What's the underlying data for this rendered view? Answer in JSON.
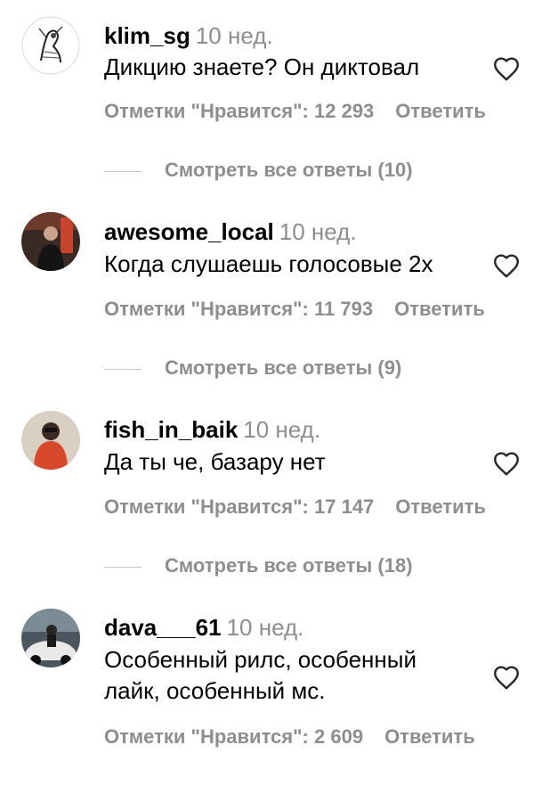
{
  "comments": [
    {
      "username": "klim_sg",
      "time": "10 нед.",
      "text": "Дикцию знаете? Он диктовал",
      "likes": "Отметки \"Нравится\": 12 293",
      "reply_label": "Ответить",
      "view_replies": "Смотреть все ответы (10)"
    },
    {
      "username": "awesome_local",
      "time": "10 нед.",
      "text": "Когда слушаешь голосовые 2х",
      "likes": "Отметки \"Нравится\": 11 793",
      "reply_label": "Ответить",
      "view_replies": "Смотреть все ответы (9)"
    },
    {
      "username": "fish_in_baik",
      "time": "10 нед.",
      "text": "Да ты че, базару нет",
      "likes": "Отметки \"Нравится\": 17 147",
      "reply_label": "Ответить",
      "view_replies": "Смотреть все ответы (18)"
    },
    {
      "username": "dava___61",
      "time": "10 нед.",
      "text_line1": "Особенный рилс, особенный",
      "text_line2": "лайк, особенный мс.",
      "likes": "Отметки \"Нравится\": 2 609",
      "reply_label": "Ответить"
    }
  ],
  "icons": {
    "like": "heart-outline-icon"
  }
}
